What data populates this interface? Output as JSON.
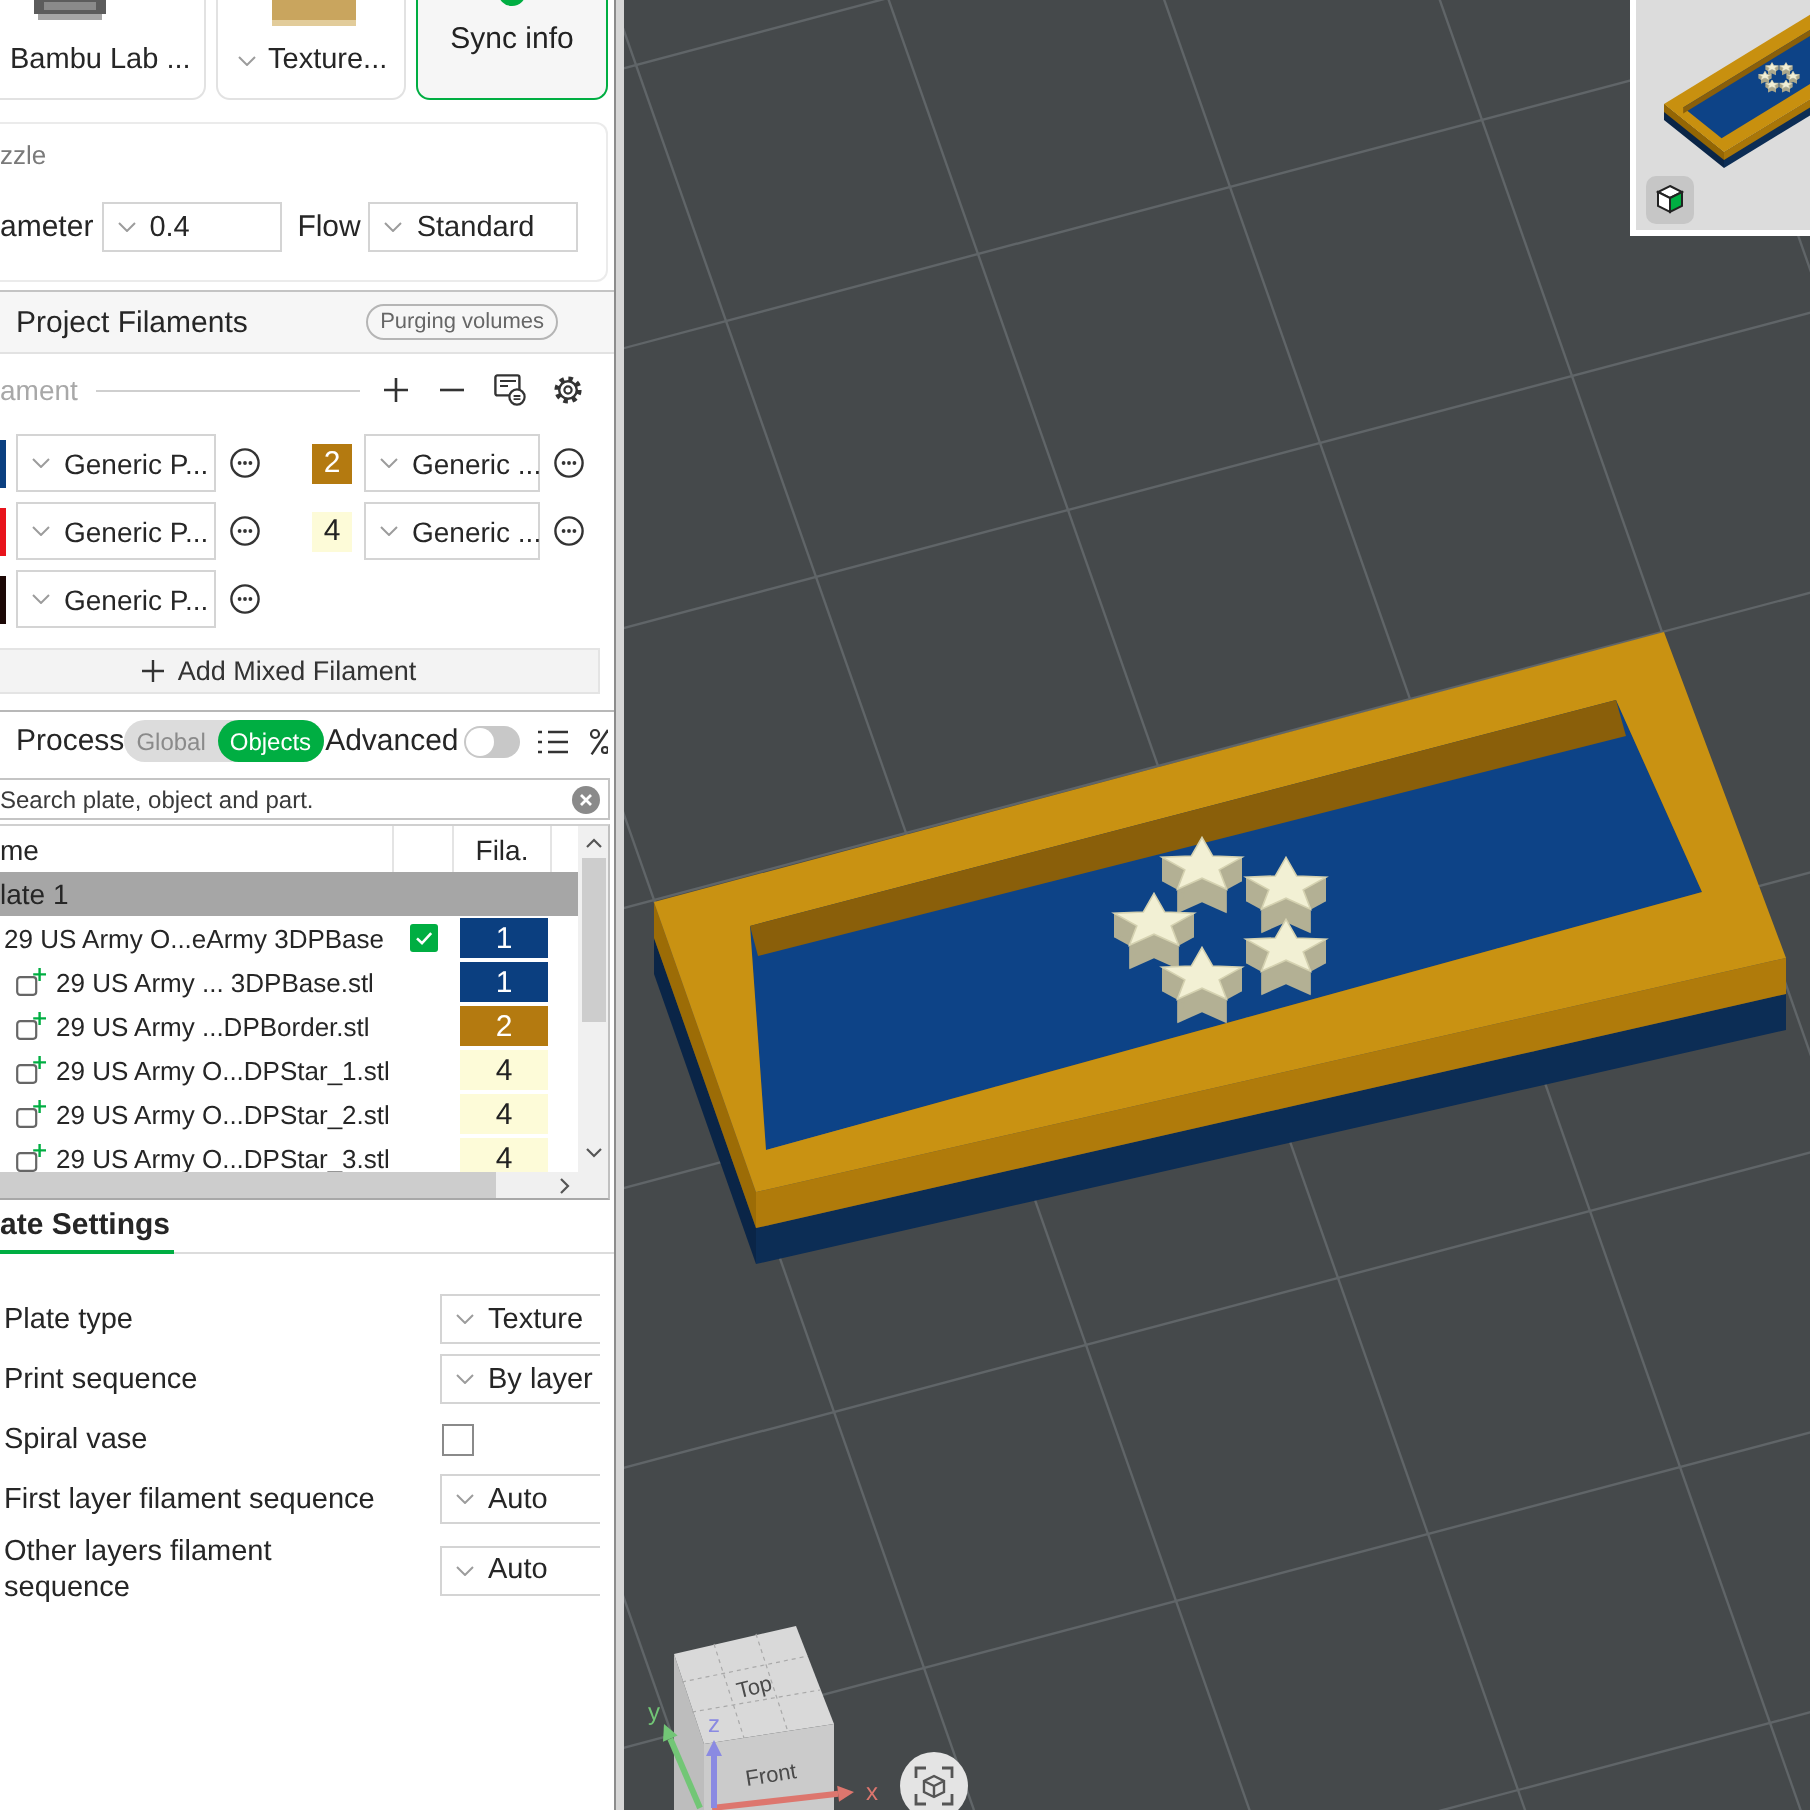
{
  "printer_bar": {
    "printer": {
      "label": "Bambu Lab ..."
    },
    "plate": {
      "label": "Texture..."
    },
    "sync_button": {
      "label": "Sync info"
    }
  },
  "nozzle": {
    "title": "zzle",
    "diameter_label": "ameter",
    "diameter": "0.4",
    "flow_label": "Flow",
    "flow": "Standard"
  },
  "project_filaments": {
    "title": "Project Filaments",
    "purging_button": "Purging volumes",
    "filament_label": "ament",
    "filaments": [
      {
        "color": "#0b3f80",
        "value": "Generic P..."
      },
      {
        "number": "2",
        "color": "#b47a10",
        "value": "Generic ..."
      },
      {
        "color": "#e8141c",
        "value": "Generic P..."
      },
      {
        "number": "4",
        "color": "#fdfbd8",
        "value": "Generic ..."
      },
      {
        "color": "#1c0806",
        "value": "Generic P..."
      }
    ],
    "add_mixed_button": "Add Mixed Filament"
  },
  "process": {
    "title": "Process",
    "modes": [
      {
        "label": "Global",
        "selected": false
      },
      {
        "label": "Objects",
        "selected": true
      }
    ],
    "advanced_label": "Advanced",
    "advanced": {
      "on": false
    }
  },
  "search": {
    "placeholder": "Search plate, object and part."
  },
  "object_list": {
    "name_header": "me",
    "filament_header": "Fila.",
    "plates": [
      {
        "label": "late 1",
        "selected": true,
        "children": [
          {
            "label": "29 US Army O...eArmy 3DPBase",
            "checked": true,
            "filament": "1",
            "color": "#0b3f80",
            "children": [
              {
                "label": "29 US Army ... 3DPBase.stl",
                "filament": "1",
                "color": "#0b3f80"
              },
              {
                "label": "29 US Army ...DPBorder.stl",
                "filament": "2",
                "color": "#b47a10"
              },
              {
                "label": "29 US Army O...DPStar_1.stl",
                "filament": "4",
                "color": "#fdfbd8"
              },
              {
                "label": "29 US Army O...DPStar_2.stl",
                "filament": "4",
                "color": "#fdfbd8"
              },
              {
                "label": "29 US Army O...DPStar_3.stl",
                "filament": "4",
                "color": "#fdfbd8"
              }
            ]
          }
        ]
      }
    ]
  },
  "plate_settings": {
    "tabs": [
      {
        "label": "ate Settings",
        "selected": true
      }
    ],
    "rows": [
      {
        "kind": "dropdown",
        "label": "Plate type",
        "value": "Texture"
      },
      {
        "kind": "dropdown",
        "label": "Print sequence",
        "value": "By layer"
      },
      {
        "kind": "checkbox",
        "label": "Spiral vase",
        "checked": false
      },
      {
        "kind": "dropdown",
        "label": "First layer filament sequence",
        "value": "Auto"
      },
      {
        "kind": "dropdown",
        "label": "Other layers filament sequence",
        "value": "Auto"
      }
    ]
  },
  "viewport": {
    "view_cube": {
      "top_label": "Top",
      "front_label": "Front",
      "axes": [
        {
          "label": "x",
          "color": "#dd766e"
        },
        {
          "label": "y",
          "color": "#72c676"
        },
        {
          "label": "z",
          "color": "#8a8ae2"
        }
      ]
    }
  }
}
